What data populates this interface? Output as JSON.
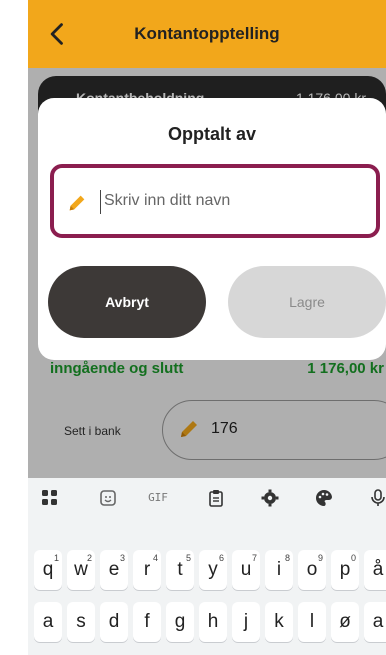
{
  "app": {
    "title": "Kontantopptelling"
  },
  "card": {
    "label": "Kontantbeholdning",
    "amount": "1 176,00 kr"
  },
  "summary": {
    "label": "inngående og slutt",
    "amount": "1 176,00 kr"
  },
  "bank": {
    "label": "Sett i bank",
    "value": "176"
  },
  "dialog": {
    "title": "Opptalt av",
    "placeholder": "Skriv inn ditt navn",
    "cancel_label": "Avbryt",
    "save_label": "Lagre"
  },
  "keyboard": {
    "gif_label": "GIF",
    "row1": [
      {
        "k": "q",
        "s": "1"
      },
      {
        "k": "w",
        "s": "2"
      },
      {
        "k": "e",
        "s": "3"
      },
      {
        "k": "r",
        "s": "4"
      },
      {
        "k": "t",
        "s": "5"
      },
      {
        "k": "y",
        "s": "6"
      },
      {
        "k": "u",
        "s": "7"
      },
      {
        "k": "i",
        "s": "8"
      },
      {
        "k": "o",
        "s": "9"
      },
      {
        "k": "p",
        "s": "0"
      },
      {
        "k": "å",
        "s": ""
      }
    ],
    "row2": [
      "a",
      "s",
      "d",
      "f",
      "g",
      "h",
      "j",
      "k",
      "l",
      "ø",
      "a"
    ]
  },
  "colors": {
    "appbar": "#f2a71b",
    "accent_border": "#8b1e4f",
    "green": "#1a9a2a",
    "pencil": "#f2a71b"
  }
}
